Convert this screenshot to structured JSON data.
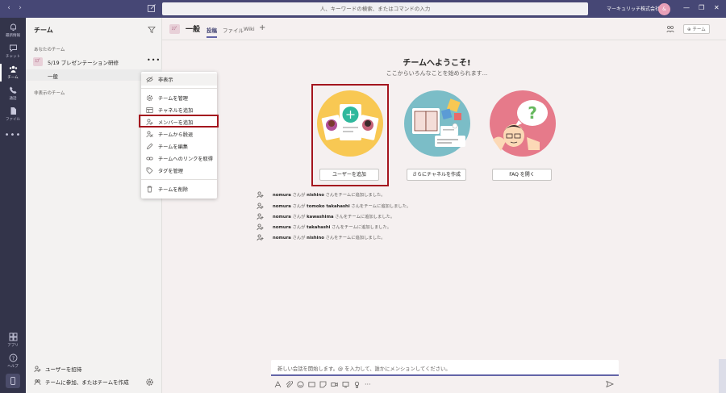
{
  "topbar": {
    "search_placeholder": "人、キーワードの検索、またはコマンドの入力",
    "org_name": "マーキュリッチ株式会社",
    "avatar_initials": "&",
    "back_icon": "chevron-left-icon",
    "forward_icon": "chevron-right-icon",
    "minimize": "—",
    "maximize": "❐",
    "close": "✕"
  },
  "rail": {
    "items": [
      {
        "label": "最新情報",
        "icon": "bell-icon"
      },
      {
        "label": "チャット",
        "icon": "chat-icon"
      },
      {
        "label": "チーム",
        "icon": "teams-icon"
      },
      {
        "label": "通話",
        "icon": "phone-icon"
      },
      {
        "label": "ファイル",
        "icon": "file-icon"
      }
    ],
    "more": "•••",
    "bottom_items": [
      {
        "label": "アプリ",
        "icon": "apps-icon"
      },
      {
        "label": "ヘルプ",
        "icon": "help-icon"
      }
    ]
  },
  "panel": {
    "title": "チーム",
    "your_teams_label": "あなたのチーム",
    "team": {
      "avatar": "ｽﾌﾟ",
      "name": "5/19 プレゼンテーション研修",
      "more": "•••"
    },
    "channel": "一般",
    "hidden_teams_label": "非表示のチーム",
    "invite_label": "ユーザーを招待",
    "join_label": "チームに参加、またはチームを作成"
  },
  "menu": {
    "items": [
      {
        "label": "非表示",
        "icon": "eye-off-icon"
      },
      {
        "label": "チームを管理",
        "icon": "gear-icon"
      },
      {
        "label": "チャネルを追加",
        "icon": "add-channel-icon"
      },
      {
        "label": "メンバーを追加",
        "icon": "add-member-icon"
      },
      {
        "label": "チームから脱退",
        "icon": "leave-icon"
      },
      {
        "label": "チームを編集",
        "icon": "pencil-icon"
      },
      {
        "label": "チームへのリンクを取得",
        "icon": "link-icon"
      },
      {
        "label": "タグを管理",
        "icon": "tag-icon"
      },
      {
        "label": "チームを削除",
        "icon": "trash-icon"
      }
    ]
  },
  "channel_header": {
    "avatar": "ｽﾌﾟ",
    "name": "一般",
    "tabs": [
      "投稿",
      "ファイル",
      "Wiki"
    ],
    "add": "+",
    "team_pill": "⊕ チーム"
  },
  "welcome": {
    "title": "チームへようこそ!",
    "subtitle": "ここからいろんなことを始められます...",
    "buttons": [
      "ユーザーを追加",
      "さらにチャネルを作成",
      "FAQ を開く"
    ]
  },
  "activity": [
    {
      "actor": "nomura",
      "mid": " さんが ",
      "target": "nishino",
      "tail": " さんをチームに追加しました。"
    },
    {
      "actor": "nomura",
      "mid": " さんが ",
      "target": "tomoko takahashi",
      "tail": " さんをチームに追加しました。"
    },
    {
      "actor": "nomura",
      "mid": " さんが ",
      "target": "kawashima",
      "tail": " さんをチームに追加しました。"
    },
    {
      "actor": "nomura",
      "mid": " さんが ",
      "target": "takahashi",
      "tail": " さんをチームに追加しました。"
    },
    {
      "actor": "nomura",
      "mid": " さんが ",
      "target": "nishino",
      "tail": " さんをチームに追加しました。"
    }
  ],
  "compose": {
    "placeholder": "新しい会話を開始します。@ を入力して、誰かにメンションしてください。"
  },
  "colors": {
    "brand": "#464775",
    "rail": "#33344a",
    "accent": "#6264a7",
    "highlight": "#a4151e"
  }
}
